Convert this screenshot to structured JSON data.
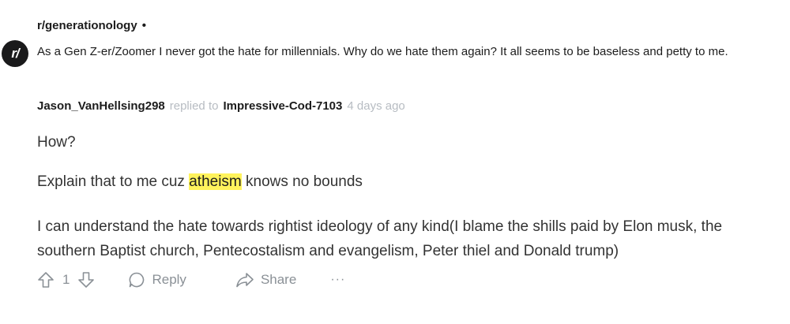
{
  "post": {
    "subreddit": "r/generationology",
    "separator": "•",
    "icon_label": "r/",
    "title": "As a Gen Z-er/Zoomer I never got the hate for millennials. Why do we hate them again? It all seems to be baseless and petty to me."
  },
  "comment": {
    "author": "Jason_VanHellsing298",
    "replied_to_label": "replied to",
    "replied_to_user": "Impressive-Cod-7103",
    "timestamp": "4 days ago",
    "paragraph_1": "How?",
    "paragraph_2_before": "Explain that to me cuz ",
    "paragraph_2_highlight": "atheism",
    "paragraph_2_after": " knows no bounds",
    "paragraph_3": "I can understand the hate towards rightist ideology of any kind(I blame the shills paid by Elon musk, the southern Baptist church, Pentecostalism and evangelism, Peter thiel and Donald trump)"
  },
  "actions": {
    "vote_count": "1",
    "reply_label": "Reply",
    "share_label": "Share",
    "more_label": "···"
  },
  "colors": {
    "highlight": "#fff35c",
    "muted": "#b7bcc2",
    "action": "#8a9096"
  }
}
